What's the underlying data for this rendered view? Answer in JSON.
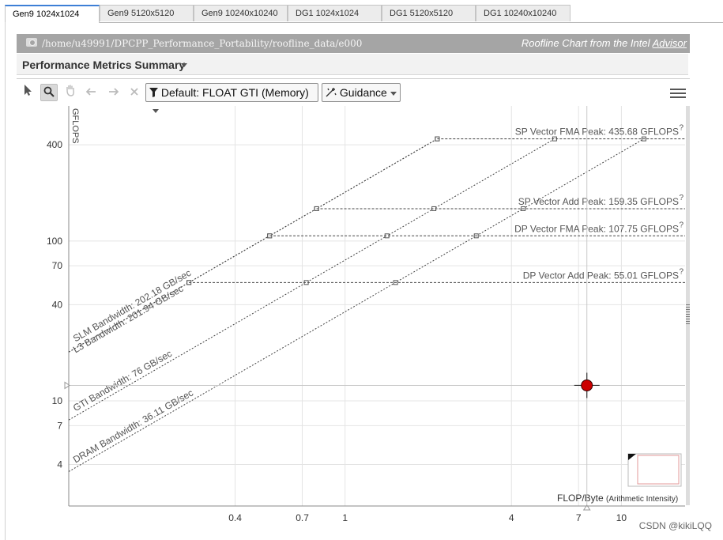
{
  "tabs": [
    {
      "label": "Gen9 1024x1024",
      "active": true
    },
    {
      "label": "Gen9 5120x5120",
      "active": false
    },
    {
      "label": "Gen9 10240x10240",
      "active": false
    },
    {
      "label": "DG1 1024x1024",
      "active": false
    },
    {
      "label": "DG1 5120x5120",
      "active": false
    },
    {
      "label": "DG1 10240x10240",
      "active": false
    }
  ],
  "header": {
    "path": "/home/u49991/DPCPP_Performance_Portability/roofline_data/e000",
    "brand_prefix": "Roofline Chart from the Intel",
    "brand_link": "Advisor"
  },
  "summary": {
    "title": "Performance Metrics Summary"
  },
  "toolbar": {
    "filter_label": "Default: FLOAT GTI (Memory)",
    "guidance_label": "Guidance",
    "icons": [
      "pointer-icon",
      "zoom-icon",
      "pan-icon",
      "undo-icon",
      "redo-icon",
      "clear-icon",
      "filter-icon",
      "guidance-wand-icon",
      "menu-icon"
    ]
  },
  "chart_data": {
    "type": "scatter",
    "xscale": "log",
    "yscale": "log",
    "xlabel": "FLOP/Byte",
    "xlabel_suffix": "(Arithmetic Intensity)",
    "ylabel": "GFLOPS",
    "x_ticks": [
      0.4,
      0.7,
      1,
      4,
      7,
      10
    ],
    "x_tick_labels": [
      "0.4",
      "0.7",
      "1",
      "4",
      "7",
      "10"
    ],
    "y_ticks": [
      4,
      7,
      10,
      40,
      70,
      100,
      400
    ],
    "y_tick_labels": [
      "4",
      "7",
      "10",
      "40",
      "70",
      "100",
      "400"
    ],
    "xlim": [
      0.1,
      17
    ],
    "ylim": [
      2.2,
      700
    ],
    "compute_roofs": [
      {
        "label": "SP Vector FMA Peak: 435.68 GFLOPS",
        "value": 435.68
      },
      {
        "label": "SP Vector Add Peak: 159.35 GFLOPS",
        "value": 159.35
      },
      {
        "label": "DP Vector FMA Peak: 107.75 GFLOPS",
        "value": 107.75
      },
      {
        "label": "DP Vector Add Peak: 55.01 GFLOPS",
        "value": 55.01
      }
    ],
    "memory_roofs": [
      {
        "label": "SLM Bandwidth: 202.18 GB/sec",
        "value": 202.18
      },
      {
        "label": "L3 Bandwidth: 201.94 GB/sec",
        "value": 201.94
      },
      {
        "label": "GTI Bandwidth: 76 GB/sec",
        "value": 76
      },
      {
        "label": "DRAM Bandwidth: 36.11 GB/sec",
        "value": 36.11
      }
    ],
    "points": [
      {
        "x": 7.5,
        "y": 12.5,
        "color": "#cc0000"
      }
    ],
    "grid": true
  },
  "watermark": "CSDN @kikiLQQ",
  "colors": {
    "accent": "#3d7fd6",
    "header_bg": "#a5a5a5",
    "point": "#cc0000"
  }
}
